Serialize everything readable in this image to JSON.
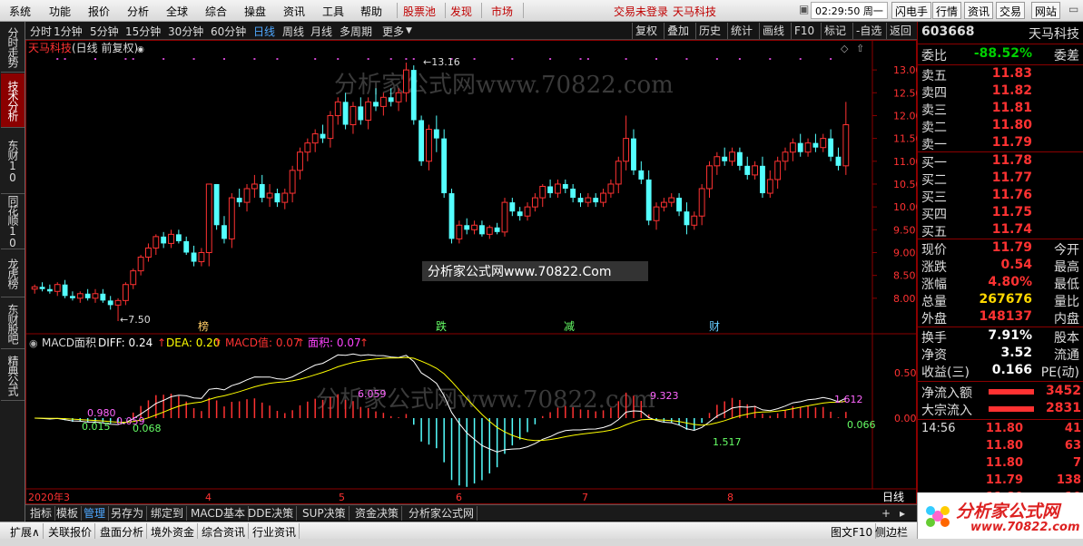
{
  "menu": {
    "items": [
      "系统",
      "功能",
      "报价",
      "分析",
      "全球",
      "综合",
      "操盘",
      "资讯",
      "工具",
      "帮助"
    ],
    "red_items": [
      "股票池",
      "发现",
      "市场"
    ],
    "login_status": "交易未登录",
    "stock_name_title": "天马科技",
    "clock": "02:29:50",
    "weekday": "周一",
    "right_buttons": [
      "闪电手",
      "行情",
      "资讯",
      "交易",
      "网站"
    ]
  },
  "left_tabs": [
    {
      "label": "分时走势",
      "active": false
    },
    {
      "label": "技术分析",
      "active": true
    },
    {
      "label": "东财10",
      "active": false
    },
    {
      "label": "同花顺10",
      "active": false
    },
    {
      "label": "龙虎榜",
      "active": false
    },
    {
      "label": "东财股吧",
      "active": false
    },
    {
      "label": "精典公式",
      "active": false
    }
  ],
  "toolbar": {
    "periods": [
      "分时",
      "1分钟",
      "5分钟",
      "15分钟",
      "30分钟",
      "60分钟",
      "日线",
      "周线",
      "月线",
      "多周期",
      "更多"
    ],
    "active_period": "日线",
    "right_items": [
      "复权",
      "叠加",
      "历史",
      "统计",
      "画线",
      "F10",
      "标记",
      "-自选",
      "返回"
    ]
  },
  "chart_header": {
    "stock": "天马科技",
    "mode": "(日线 前复权)",
    "high_label": "13.16",
    "low_label": "7.50",
    "axis_main": [
      "13.00",
      "12.50",
      "12.00",
      "11.50",
      "11.00",
      "10.50",
      "10.00",
      "9.50",
      "9.00",
      "8.50",
      "8.00"
    ],
    "axis_macd": [
      "0.50",
      "0.00"
    ],
    "event_labels": [
      "榜",
      "跌",
      "减",
      "财"
    ],
    "ad_text": "分析家公式网www.70822.Com",
    "watermark": "分析家公式网www.70822.com"
  },
  "macd_header": {
    "name": "MACD面积",
    "diff_label": "DIFF:",
    "diff": "0.24",
    "dea_label": "DEA:",
    "dea": "0.20",
    "macd_label": "MACD值:",
    "macd": "0.07",
    "area_label": "面积:",
    "area": "0.07",
    "annotations": [
      "0.980",
      "0.015",
      "0.059",
      "0.068",
      "6.059",
      "9.323",
      "1.517",
      "1.612",
      "0.066"
    ]
  },
  "x_axis": {
    "labels": [
      "2020年3",
      "4",
      "5",
      "6",
      "7",
      "8"
    ],
    "right_label": "日线"
  },
  "chart_data": {
    "type": "candlestick",
    "title": "天马科技 (日线 前复权)",
    "ylim": [
      7.5,
      13.3
    ],
    "candles": [
      [
        8.2,
        8.25,
        8.15,
        8.1,
        8.3
      ],
      [
        8.25,
        8.2,
        8.3,
        8.15,
        8.35
      ],
      [
        8.2,
        8.15,
        8.25,
        8.1,
        8.3
      ],
      [
        8.15,
        8.3,
        8.1,
        8.05,
        8.35
      ],
      [
        8.3,
        8.05,
        8.35,
        8.0,
        8.4
      ],
      [
        8.05,
        8.0,
        8.1,
        7.95,
        8.15
      ],
      [
        8.0,
        8.1,
        7.95,
        7.9,
        8.15
      ],
      [
        8.1,
        8.0,
        8.15,
        7.95,
        8.2
      ],
      [
        8.0,
        8.1,
        7.95,
        7.9,
        8.2
      ],
      [
        8.1,
        7.95,
        8.15,
        7.9,
        8.2
      ],
      [
        7.95,
        7.85,
        8.0,
        7.75,
        8.05
      ],
      [
        7.85,
        7.95,
        7.8,
        7.5,
        8.0
      ],
      [
        7.95,
        8.3,
        7.9,
        7.85,
        8.35
      ],
      [
        8.3,
        8.6,
        8.25,
        8.2,
        8.65
      ],
      [
        8.6,
        8.9,
        8.55,
        8.5,
        8.95
      ],
      [
        8.9,
        9.1,
        8.85,
        8.8,
        9.2
      ],
      [
        9.1,
        9.35,
        9.0,
        8.95,
        9.4
      ],
      [
        9.35,
        9.2,
        9.4,
        9.1,
        9.45
      ],
      [
        9.2,
        9.4,
        9.15,
        9.1,
        9.5
      ],
      [
        9.4,
        9.25,
        9.45,
        9.2,
        9.5
      ],
      [
        9.25,
        9.0,
        9.3,
        8.95,
        9.35
      ],
      [
        9.0,
        8.8,
        9.1,
        8.7,
        9.15
      ],
      [
        8.8,
        9.0,
        8.75,
        8.7,
        9.1
      ],
      [
        9.0,
        10.5,
        8.8,
        8.7,
        10.5
      ],
      [
        10.5,
        9.6,
        10.4,
        9.5,
        10.5
      ],
      [
        9.6,
        9.3,
        9.7,
        9.2,
        9.8
      ],
      [
        9.3,
        10.2,
        9.2,
        9.1,
        10.3
      ],
      [
        10.2,
        10.1,
        10.3,
        10.0,
        10.4
      ],
      [
        10.1,
        10.4,
        10.0,
        9.9,
        10.5
      ],
      [
        10.4,
        10.5,
        10.3,
        10.2,
        10.7
      ],
      [
        10.5,
        10.2,
        10.6,
        10.1,
        10.7
      ],
      [
        10.2,
        10.3,
        10.1,
        10.0,
        10.5
      ],
      [
        10.3,
        10.1,
        10.35,
        10.0,
        10.4
      ],
      [
        10.1,
        10.3,
        10.0,
        9.95,
        10.4
      ],
      [
        10.3,
        10.8,
        10.2,
        10.1,
        10.9
      ],
      [
        10.8,
        11.2,
        10.7,
        10.6,
        11.3
      ],
      [
        11.2,
        11.4,
        11.1,
        11.0,
        11.5
      ],
      [
        11.4,
        11.6,
        11.3,
        11.2,
        11.7
      ],
      [
        11.6,
        11.5,
        11.7,
        11.4,
        11.8
      ],
      [
        11.5,
        12.0,
        11.4,
        11.3,
        12.1
      ],
      [
        12.0,
        12.3,
        11.9,
        11.8,
        12.4
      ],
      [
        12.3,
        11.8,
        12.4,
        11.7,
        12.5
      ],
      [
        11.8,
        12.2,
        11.7,
        11.6,
        12.3
      ],
      [
        12.2,
        11.9,
        12.3,
        11.8,
        12.4
      ],
      [
        11.9,
        12.3,
        11.8,
        11.7,
        12.4
      ],
      [
        12.3,
        12.2,
        12.4,
        12.1,
        12.6
      ],
      [
        12.2,
        12.4,
        12.1,
        12.0,
        12.5
      ],
      [
        12.4,
        12.3,
        12.5,
        12.2,
        12.6
      ],
      [
        12.3,
        12.5,
        12.2,
        12.1,
        12.6
      ],
      [
        12.5,
        13.0,
        12.4,
        12.3,
        13.16
      ],
      [
        13.0,
        11.9,
        12.9,
        11.8,
        13.1
      ],
      [
        11.9,
        11.0,
        11.8,
        10.9,
        12.0
      ],
      [
        11.0,
        11.7,
        10.9,
        10.8,
        11.8
      ],
      [
        11.7,
        11.5,
        11.8,
        11.2,
        12.0
      ],
      [
        11.5,
        10.3,
        11.6,
        10.2,
        11.7
      ],
      [
        10.3,
        9.3,
        10.2,
        9.2,
        10.4
      ],
      [
        9.3,
        9.6,
        9.25,
        9.2,
        9.7
      ],
      [
        9.6,
        9.5,
        9.7,
        9.4,
        9.75
      ],
      [
        9.5,
        9.6,
        9.45,
        9.4,
        9.7
      ],
      [
        9.6,
        9.4,
        9.65,
        9.35,
        9.7
      ],
      [
        9.4,
        9.55,
        9.35,
        9.3,
        9.6
      ],
      [
        9.55,
        9.45,
        9.6,
        9.4,
        9.65
      ],
      [
        9.45,
        10.1,
        9.4,
        9.35,
        10.2
      ],
      [
        10.1,
        9.9,
        10.15,
        9.8,
        10.2
      ],
      [
        9.9,
        9.8,
        9.95,
        9.7,
        10.0
      ],
      [
        9.8,
        10.0,
        9.75,
        9.7,
        10.1
      ],
      [
        10.0,
        10.2,
        9.95,
        9.9,
        10.3
      ],
      [
        10.2,
        10.45,
        10.1,
        10.0,
        10.5
      ],
      [
        10.45,
        10.3,
        10.5,
        10.2,
        10.6
      ],
      [
        10.3,
        10.5,
        10.25,
        10.2,
        10.6
      ],
      [
        10.5,
        10.4,
        10.55,
        10.3,
        10.6
      ],
      [
        10.4,
        10.2,
        10.45,
        10.1,
        10.5
      ],
      [
        10.2,
        10.1,
        10.25,
        10.0,
        10.3
      ],
      [
        10.1,
        10.2,
        10.05,
        10.0,
        10.3
      ],
      [
        10.2,
        10.1,
        10.25,
        10.0,
        10.3
      ],
      [
        10.1,
        10.3,
        10.05,
        10.0,
        10.4
      ],
      [
        10.3,
        10.5,
        10.25,
        10.2,
        10.6
      ],
      [
        10.5,
        11.0,
        10.4,
        10.3,
        11.1
      ],
      [
        11.0,
        11.5,
        10.9,
        10.8,
        12.0
      ],
      [
        11.5,
        10.8,
        11.6,
        10.7,
        11.7
      ],
      [
        10.8,
        10.6,
        10.9,
        10.5,
        11.0
      ],
      [
        10.6,
        9.7,
        10.7,
        9.6,
        10.8
      ],
      [
        9.7,
        10.0,
        9.6,
        9.5,
        10.1
      ],
      [
        10.0,
        10.1,
        9.95,
        9.9,
        10.2
      ],
      [
        10.1,
        10.2,
        10.05,
        10.0,
        10.3
      ],
      [
        10.2,
        9.9,
        10.25,
        9.8,
        10.3
      ],
      [
        9.9,
        9.6,
        10.0,
        9.4,
        10.1
      ],
      [
        9.6,
        9.8,
        9.55,
        9.5,
        9.9
      ],
      [
        9.8,
        10.4,
        9.7,
        9.6,
        10.5
      ],
      [
        10.4,
        10.9,
        10.3,
        10.2,
        11.0
      ],
      [
        10.9,
        11.1,
        10.8,
        10.7,
        11.2
      ],
      [
        11.1,
        11.0,
        11.2,
        10.9,
        11.3
      ],
      [
        11.0,
        11.2,
        10.95,
        10.9,
        11.3
      ],
      [
        11.2,
        10.9,
        11.25,
        10.8,
        11.3
      ],
      [
        10.9,
        10.7,
        11.0,
        10.6,
        11.1
      ],
      [
        10.7,
        10.9,
        10.65,
        10.6,
        11.0
      ],
      [
        10.9,
        10.3,
        11.0,
        10.2,
        11.1
      ],
      [
        10.3,
        10.6,
        10.25,
        10.2,
        10.8
      ],
      [
        10.6,
        11.0,
        10.5,
        10.4,
        11.1
      ],
      [
        11.0,
        11.2,
        10.9,
        10.8,
        11.3
      ],
      [
        11.2,
        11.4,
        11.1,
        11.0,
        11.5
      ],
      [
        11.4,
        11.2,
        11.5,
        11.1,
        11.6
      ],
      [
        11.2,
        11.4,
        11.15,
        11.1,
        11.5
      ],
      [
        11.4,
        11.3,
        11.5,
        11.2,
        11.6
      ],
      [
        11.3,
        11.5,
        11.25,
        11.2,
        11.6
      ],
      [
        11.5,
        11.1,
        11.6,
        11.0,
        11.7
      ],
      [
        11.1,
        10.9,
        11.2,
        10.8,
        11.3
      ],
      [
        10.9,
        11.8,
        10.8,
        10.7,
        12.3
      ]
    ]
  },
  "quote": {
    "code": "603668",
    "name": "天马科技",
    "weibi_label": "委比",
    "weibi": "-88.52%",
    "weicha_label": "委差",
    "sells": [
      {
        "label": "卖五",
        "price": "11.83"
      },
      {
        "label": "卖四",
        "price": "11.82"
      },
      {
        "label": "卖三",
        "price": "11.81"
      },
      {
        "label": "卖二",
        "price": "11.80"
      },
      {
        "label": "卖一",
        "price": "11.79"
      }
    ],
    "buys": [
      {
        "label": "买一",
        "price": "11.78"
      },
      {
        "label": "买二",
        "price": "11.77"
      },
      {
        "label": "买三",
        "price": "11.76"
      },
      {
        "label": "买四",
        "price": "11.75"
      },
      {
        "label": "买五",
        "price": "11.74"
      }
    ],
    "stats": [
      {
        "label": "现价",
        "value": "11.79",
        "label2": "今开",
        "color": "red"
      },
      {
        "label": "涨跌",
        "value": "0.54",
        "label2": "最高",
        "color": "red"
      },
      {
        "label": "涨幅",
        "value": "4.80%",
        "label2": "最低",
        "color": "red"
      },
      {
        "label": "总量",
        "value": "267676",
        "label2": "量比",
        "color": "yellow"
      },
      {
        "label": "外盘",
        "value": "148137",
        "label2": "内盘",
        "color": "red"
      }
    ],
    "stats2": [
      {
        "label": "换手",
        "value": "7.91%",
        "label2": "股本",
        "color": "white"
      },
      {
        "label": "净资",
        "value": "3.52",
        "label2": "流通",
        "color": "white"
      },
      {
        "label": "收益(三)",
        "value": "0.166",
        "label2": "PE(动)",
        "color": "white"
      }
    ],
    "flows": [
      {
        "label": "净流入额",
        "value": "3452"
      },
      {
        "label": "大宗流入",
        "value": "2831"
      }
    ],
    "ticks": [
      {
        "time": "14:56",
        "price": "11.80",
        "vol": "41"
      },
      {
        "time": "",
        "price": "11.80",
        "vol": "63"
      },
      {
        "time": "",
        "price": "11.80",
        "vol": "7"
      },
      {
        "time": "",
        "price": "11.79",
        "vol": "138"
      },
      {
        "time": "",
        "price": "11.80",
        "vol": "10"
      }
    ]
  },
  "bottom_tabs1": {
    "items": [
      "指标",
      "模板",
      "管理",
      "另存为",
      "绑定到",
      "MACD基本",
      "DDE决策",
      "SUP决策",
      "资金决策",
      "分析家公式网"
    ],
    "active": "管理"
  },
  "bottom_tabs2": {
    "items": [
      "扩展∧",
      "关联报价",
      "盘面分析",
      "境外资金",
      "综合资讯",
      "行业资讯"
    ],
    "right": [
      "图文F10",
      "侧边栏"
    ]
  },
  "logo": {
    "text": "分析家公式网",
    "url": "www.70822.com"
  },
  "colors": {
    "up": "#ff3232",
    "down": "#54ffff",
    "diff": "#ffffff",
    "dea": "#ffff00",
    "frame": "#8b0000"
  }
}
